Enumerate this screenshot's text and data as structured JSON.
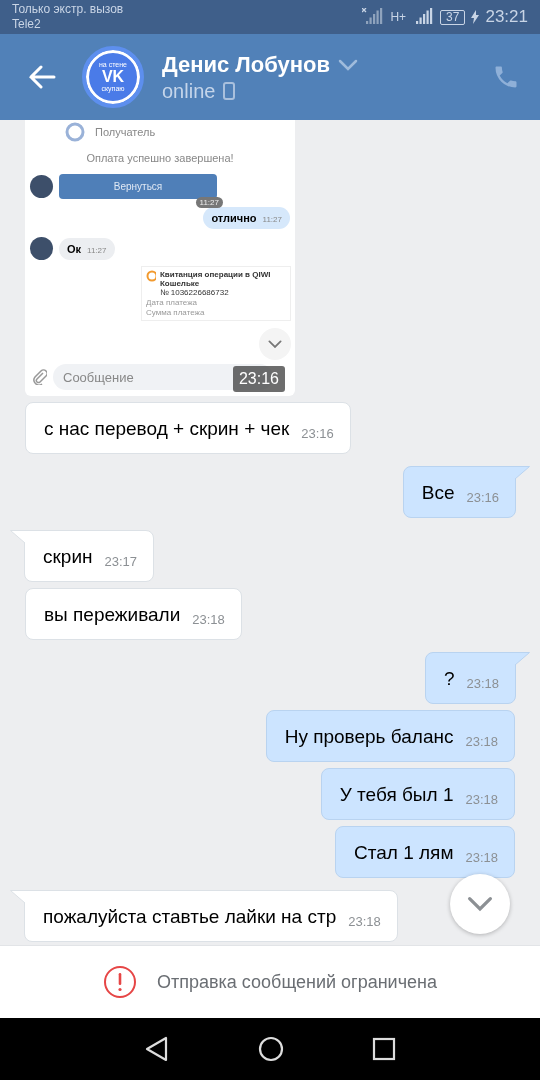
{
  "status_bar": {
    "notice": "Только экстр. вызов",
    "carrier": "Tele2",
    "battery": "37",
    "network": "H+",
    "time": "23:21"
  },
  "header": {
    "avatar_top": "на стене",
    "avatar_logo": "VK",
    "avatar_bottom": "скупаю",
    "name": "Денис Лобунов",
    "status": "online"
  },
  "shared_screenshot": {
    "recipient": "Получатель",
    "success": "Оплата успешно завершена!",
    "button": "Вернуться",
    "button_time": "11:27",
    "messages": [
      {
        "outgoing": true,
        "text": "отлично",
        "time": "11:27"
      },
      {
        "outgoing": false,
        "text": "Ок",
        "time": "11:27"
      }
    ],
    "receipt_title": "Квитанция операции в QIWI Кошельке",
    "receipt_number": "№ 1036226686732",
    "receipt_date": "Дата платежа",
    "receipt_sum": "Сумма платежа",
    "input_placeholder": "Сообщение",
    "time": "23:16"
  },
  "messages": [
    {
      "outgoing": false,
      "tail": false,
      "text": "с нас перевод + скрин + чек",
      "time": "23:16"
    },
    {
      "outgoing": true,
      "tail": true,
      "text": "Все",
      "time": "23:16"
    },
    {
      "outgoing": false,
      "tail": true,
      "text": "скрин",
      "time": "23:17"
    },
    {
      "outgoing": false,
      "tail": false,
      "text": "вы переживали",
      "time": "23:18"
    },
    {
      "outgoing": true,
      "tail": true,
      "text": "?",
      "time": "23:18"
    },
    {
      "outgoing": true,
      "tail": false,
      "text": "Ну проверь баланс",
      "time": "23:18"
    },
    {
      "outgoing": true,
      "tail": false,
      "text": "У тебя был 1",
      "time": "23:18"
    },
    {
      "outgoing": true,
      "tail": false,
      "text": "Стал 1 лям",
      "time": "23:18"
    },
    {
      "outgoing": false,
      "tail": true,
      "text": "пожалуйста ставтье лайки на стр",
      "time": "23:18"
    }
  ],
  "restriction": "Отправка сообщений ограничена"
}
